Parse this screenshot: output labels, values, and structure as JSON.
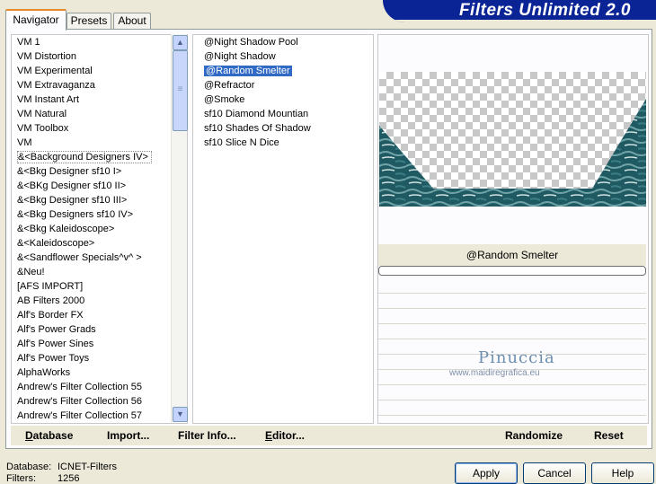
{
  "app": {
    "title": "Filters Unlimited 2.0"
  },
  "tabs": [
    {
      "label": "Navigator",
      "active": true
    },
    {
      "label": "Presets",
      "active": false
    },
    {
      "label": "About",
      "active": false
    }
  ],
  "categories": {
    "items": [
      "VM 1",
      "VM Distortion",
      "VM Experimental",
      "VM Extravaganza",
      "VM Instant Art",
      "VM Natural",
      "VM Toolbox",
      "VM",
      "&<Background Designers IV>",
      "&<Bkg Designer sf10 I>",
      "&<BKg Designer sf10 II>",
      "&<Bkg Designer sf10 III>",
      "&<Bkg Designers sf10 IV>",
      "&<Bkg Kaleidoscope>",
      "&<Kaleidoscope>",
      "&<Sandflower Specials^v^ >",
      "&Neu!",
      "[AFS IMPORT]",
      "AB Filters 2000",
      "Alf's Border FX",
      "Alf's Power Grads",
      "Alf's Power Sines",
      "Alf's Power Toys",
      "AlphaWorks",
      "Andrew's Filter Collection 55",
      "Andrew's Filter Collection 56",
      "Andrew's Filter Collection 57"
    ],
    "selected_index": 8
  },
  "filters": {
    "items": [
      "@Night Shadow Pool",
      "@Night Shadow",
      "@Random Smelter",
      "@Refractor",
      "@Smoke",
      "sf10 Diamond Mountian",
      "sf10 Shades Of Shadow",
      "sf10 Slice N Dice"
    ],
    "selected_index": 2
  },
  "preview": {
    "filter_name": "@Random Smelter",
    "colors": {
      "teal": "#1f5a63",
      "teal_light": "#6fa3a8",
      "checker": "#c8c8c8"
    }
  },
  "watermark": {
    "name": "Pinuccia",
    "site": "www.maidiregrafica.eu"
  },
  "toolbar": {
    "database": "Database",
    "import": "Import...",
    "filter_info": "Filter Info...",
    "editor": "Editor...",
    "randomize": "Randomize",
    "reset": "Reset"
  },
  "status": {
    "database_label": "Database:",
    "database_value": "ICNET-Filters",
    "filters_label": "Filters:",
    "filters_value": "1256"
  },
  "buttons": {
    "apply": "Apply",
    "cancel": "Cancel",
    "help": "Help"
  },
  "icons": {
    "scroll_up": "▲",
    "scroll_down": "▼",
    "grip": "≡"
  }
}
